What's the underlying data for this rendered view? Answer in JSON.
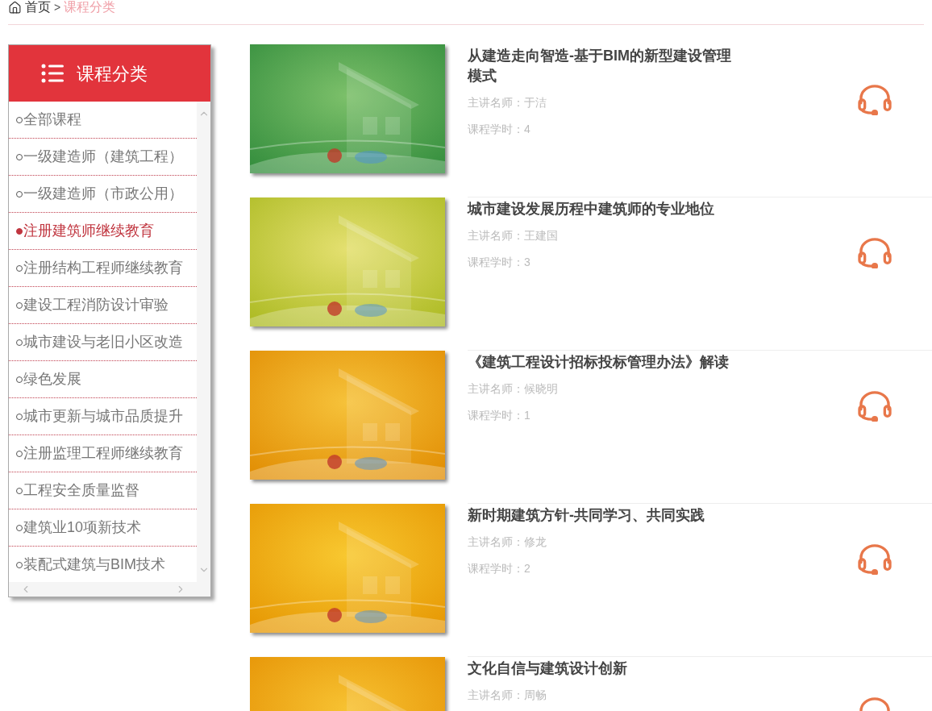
{
  "breadcrumb": {
    "items": [
      {
        "label": "首页",
        "selected": false
      },
      {
        "label": "课程分类",
        "selected": true
      }
    ],
    "separator": ">"
  },
  "sidebar": {
    "title": "课程分类",
    "items": [
      {
        "label": "全部课程",
        "selected": false
      },
      {
        "label": "一级建造师（建筑工程）",
        "selected": false
      },
      {
        "label": "一级建造师（市政公用）",
        "selected": false
      },
      {
        "label": "注册建筑师继续教育",
        "selected": true
      },
      {
        "label": "注册结构工程师继续教育",
        "selected": false
      },
      {
        "label": "建设工程消防设计审验",
        "selected": false
      },
      {
        "label": "城市建设与老旧小区改造",
        "selected": false
      },
      {
        "label": "绿色发展",
        "selected": false
      },
      {
        "label": "城市更新与城市品质提升",
        "selected": false
      },
      {
        "label": "注册监理工程师继续教育",
        "selected": false
      },
      {
        "label": "工程安全质量监督",
        "selected": false
      },
      {
        "label": "建筑业10项新技术",
        "selected": false
      },
      {
        "label": "装配式建筑与BIM技术",
        "selected": false
      }
    ]
  },
  "courses": [
    {
      "title": "从建造走向智造-基于BIM的新型建设管理模式",
      "teacher": "主讲名师：于洁",
      "hours": "课程学时：4"
    },
    {
      "title": "城市建设发展历程中建筑师的专业地位",
      "teacher": "主讲名师：王建国",
      "hours": "课程学时：3"
    },
    {
      "title": "《建筑工程设计招标投标管理办法》解读",
      "teacher": "主讲名师：候晓明",
      "hours": "课程学时：1"
    },
    {
      "title": "新时期建筑方针-共同学习、共同实践",
      "teacher": "主讲名师：修龙",
      "hours": "课程学时：2"
    },
    {
      "title": "文化自信与建筑设计创新",
      "teacher": "主讲名师：周畅"
    }
  ]
}
